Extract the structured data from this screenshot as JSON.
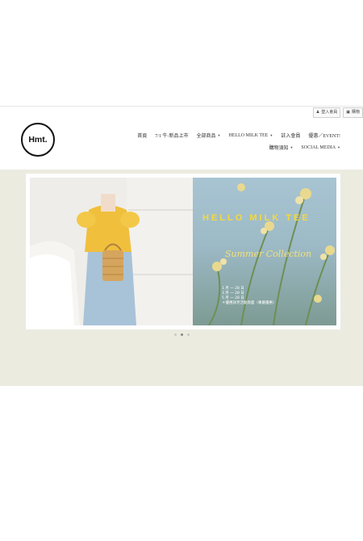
{
  "top_bar": {
    "login_label": "登入會員",
    "cart_label": "購物"
  },
  "logo": {
    "text": "Hmt."
  },
  "nav": {
    "row1": [
      {
        "label": "首頁",
        "dropdown": false
      },
      {
        "label": "7/1 牛-新品上市",
        "dropdown": false
      },
      {
        "label": "全部商品",
        "dropdown": true
      },
      {
        "label": "HELLO MILK TEE",
        "dropdown": true
      },
      {
        "label": "註入會員",
        "dropdown": false
      },
      {
        "label": "優惠／EVENT!",
        "dropdown": false
      }
    ],
    "row2": [
      {
        "label": "購物須知",
        "dropdown": true
      },
      {
        "label": "SOCIAL MEDIA",
        "dropdown": true
      }
    ]
  },
  "banner": {
    "headline": "HELLO MILK TEE",
    "subtitle": "Summer Collection",
    "info_lines": [
      "1 月 一 28 日",
      "3 月 一 28 日",
      "5 月 一 28 日",
      "＊優惠詳見活動頁面（專屬優惠）"
    ]
  },
  "carousel": {
    "slide_count": 3,
    "active_index": 1
  },
  "colors": {
    "hero_bg": "#ebebe0",
    "headline": "#f5d93a"
  }
}
